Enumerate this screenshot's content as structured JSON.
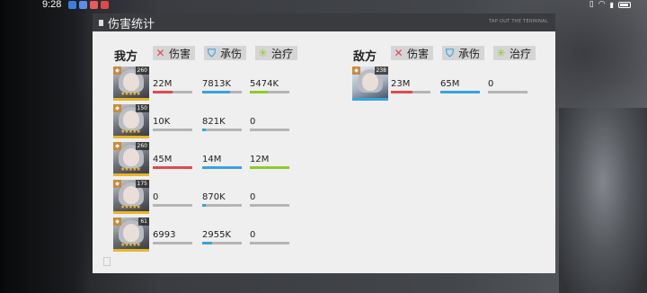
{
  "status_bar": {
    "time": "9:28",
    "app_icon_colors": [
      "#3b7de0",
      "#5c8ee8",
      "#e85b5b",
      "#e04848"
    ]
  },
  "panel": {
    "title": "伤害统计",
    "header_small": "TAP OUT THE TERMINAL"
  },
  "colors": {
    "damage": "#e04a4a",
    "tank": "#3aa2e0",
    "heal": "#8ccc2a",
    "track": "#b5b5b5"
  },
  "ally": {
    "label": "我方",
    "headers": {
      "damage": "伤害",
      "tank": "承伤",
      "heal": "治疗"
    },
    "units": [
      {
        "level": "260",
        "damage": "22M",
        "tank": "7813K",
        "heal": "5474K",
        "damage_fill": 0.5,
        "tank_fill": 0.7,
        "heal_fill": 0.45
      },
      {
        "level": "150",
        "damage": "10K",
        "tank": "821K",
        "heal": "0",
        "damage_fill": 0.0,
        "tank_fill": 0.08,
        "heal_fill": 0.0
      },
      {
        "level": "260",
        "damage": "45M",
        "tank": "14M",
        "heal": "12M",
        "damage_fill": 1.0,
        "tank_fill": 1.0,
        "heal_fill": 1.0
      },
      {
        "level": "175",
        "damage": "0",
        "tank": "870K",
        "heal": "0",
        "damage_fill": 0.0,
        "tank_fill": 0.08,
        "heal_fill": 0.0
      },
      {
        "level": "61",
        "damage": "6993",
        "tank": "2955K",
        "heal": "0",
        "damage_fill": 0.0,
        "tank_fill": 0.25,
        "heal_fill": 0.0
      }
    ]
  },
  "enemy": {
    "label": "敌方",
    "headers": {
      "damage": "伤害",
      "tank": "承伤",
      "heal": "治疗"
    },
    "units": [
      {
        "level": "238",
        "damage": "23M",
        "tank": "65M",
        "heal": "0",
        "damage_fill": 0.55,
        "tank_fill": 1.0,
        "heal_fill": 0.0
      }
    ]
  }
}
